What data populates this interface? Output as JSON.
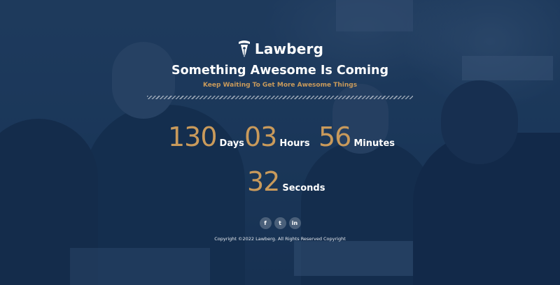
{
  "brand": {
    "name": "Lawberg",
    "logo_icon": "pen-nib-icon"
  },
  "headline": "Something Awesome Is Coming",
  "subheadline": "Keep Waiting To Get More Awesome Things",
  "countdown": [
    {
      "value": "130",
      "unit": "Days"
    },
    {
      "value": "03",
      "unit": "Hours"
    },
    {
      "value": "56",
      "unit": "Minutes"
    },
    {
      "value": "32",
      "unit": "Seconds"
    }
  ],
  "social": [
    {
      "label": "f",
      "icon": "facebook-icon"
    },
    {
      "label": "t",
      "icon": "twitter-icon"
    },
    {
      "label": "in",
      "icon": "linkedin-icon"
    }
  ],
  "copyright": "Copyright ©2022 Lawberg. All Rights Reserved Copyright",
  "colors": {
    "accent": "#c99a5b",
    "overlay": "#1f3d5e",
    "text": "#ffffff"
  }
}
